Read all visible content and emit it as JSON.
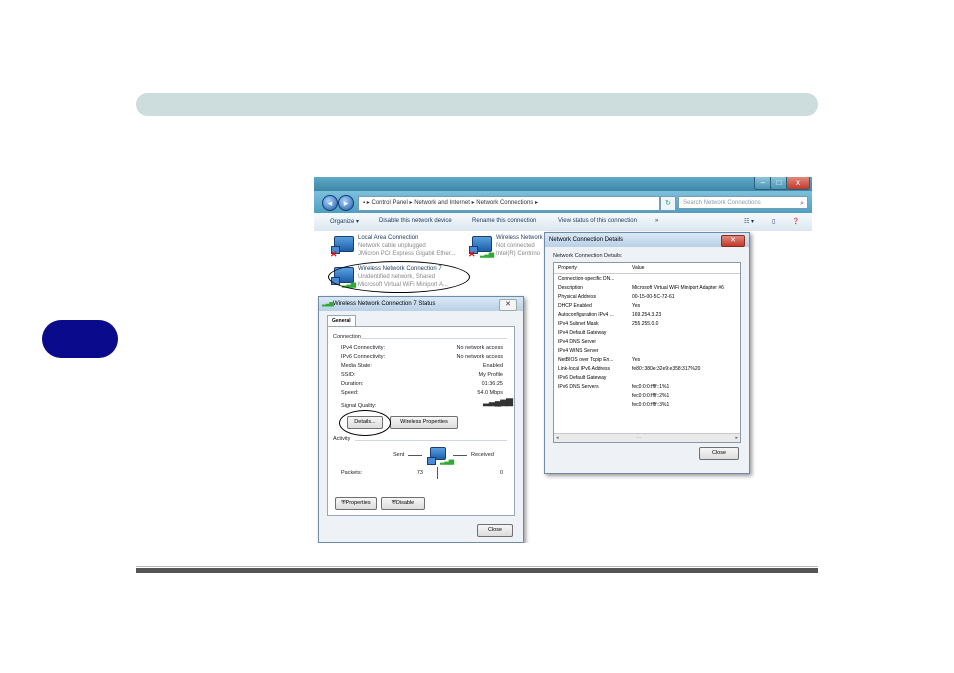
{
  "explorer": {
    "address": [
      "Control Panel",
      "Network and Internet",
      "Network Connections"
    ],
    "search_placeholder": "Search Network Connections",
    "commands": [
      "Organize ▾",
      "Disable this network device",
      "Rename this connection",
      "View status of this connection",
      "»"
    ],
    "connections": [
      {
        "name": "Local Area Connection",
        "status": "Network cable unplugged",
        "device": "JMicron PCI Express Gigabit Ether..."
      },
      {
        "name": "Wireless Network",
        "status": "Not connected",
        "device": "Intel(R) Centrino"
      },
      {
        "name": "Wireless Network Connection 7",
        "status": "Unidentified network, Shared",
        "device": "Microsoft Virtual WiFi Miniport A..."
      }
    ]
  },
  "status_dialog": {
    "title": "Wireless Network Connection 7 Status",
    "tab": "General",
    "connection_heading": "Connection",
    "rows": [
      {
        "label": "IPv4 Connectivity:",
        "value": "No network access"
      },
      {
        "label": "IPv6 Connectivity:",
        "value": "No network access"
      },
      {
        "label": "Media State:",
        "value": "Enabled"
      },
      {
        "label": "SSID:",
        "value": "My Profile"
      },
      {
        "label": "Duration:",
        "value": "01:36:25"
      },
      {
        "label": "Speed:",
        "value": "54.0 Mbps"
      }
    ],
    "signal_label": "Signal Quality:",
    "details_button": "Details...",
    "wireless_props_button": "Wireless Properties",
    "activity_heading": "Activity",
    "sent_label": "Sent",
    "received_label": "Received",
    "packets_label": "Packets:",
    "packets_sent": "73",
    "packets_received": "0",
    "properties_button": "Properties",
    "disable_button": "Disable",
    "close_button": "Close"
  },
  "details_dialog": {
    "title": "Network Connection Details",
    "heading": "Network Connection Details:",
    "col_property": "Property",
    "col_value": "Value",
    "rows": [
      {
        "p": "Connection-specific DN...",
        "v": ""
      },
      {
        "p": "Description",
        "v": "Microsoft Virtual WiFi Miniport Adapter #6"
      },
      {
        "p": "Physical Address",
        "v": "00-15-00-5C-72-61"
      },
      {
        "p": "DHCP Enabled",
        "v": "Yes"
      },
      {
        "p": "Autoconfiguration IPv4 ...",
        "v": "169.254.3.23"
      },
      {
        "p": "IPv4 Subnet Mask",
        "v": "255.255.0.0"
      },
      {
        "p": "IPv4 Default Gateway",
        "v": ""
      },
      {
        "p": "IPv4 DNS Server",
        "v": ""
      },
      {
        "p": "IPv4 WINS Server",
        "v": ""
      },
      {
        "p": "NetBIOS over Tcpip En...",
        "v": "Yes"
      },
      {
        "p": "Link-local IPv6 Address",
        "v": "fe80::380e:32e9:e358:317%20"
      },
      {
        "p": "IPv6 Default Gateway",
        "v": ""
      },
      {
        "p": "IPv6 DNS Servers",
        "v": "fec0:0:0:ffff::1%1"
      },
      {
        "p": "",
        "v": "fec0:0:0:ffff::2%1"
      },
      {
        "p": "",
        "v": "fec0:0:0:ffff::3%1"
      }
    ],
    "close_button": "Close"
  }
}
